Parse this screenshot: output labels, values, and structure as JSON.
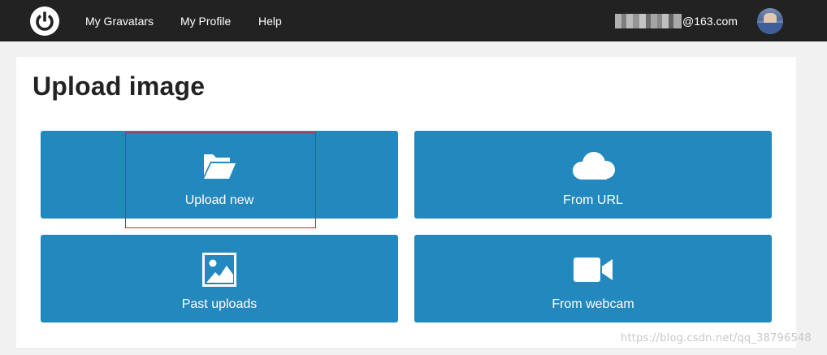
{
  "header": {
    "logo_icon": "gravatar-power-logo-icon",
    "nav": {
      "my_gravatars": "My Gravatars",
      "my_profile": "My Profile",
      "help": "Help"
    },
    "account_email_suffix": "@163.com",
    "avatar_icon": "user-avatar-icon"
  },
  "main": {
    "title": "Upload image",
    "options": {
      "upload_new": {
        "label": "Upload new",
        "icon": "folder-open-icon"
      },
      "from_url": {
        "label": "From URL",
        "icon": "cloud-icon"
      },
      "past_uploads": {
        "label": "Past uploads",
        "icon": "image-icon"
      },
      "from_webcam": {
        "label": "From webcam",
        "icon": "video-camera-icon"
      }
    }
  },
  "watermark": "https://blog.csdn.net/qq_38796548",
  "colors": {
    "topbar": "#222222",
    "tile": "#2388bd",
    "highlight": "#e21b23"
  }
}
